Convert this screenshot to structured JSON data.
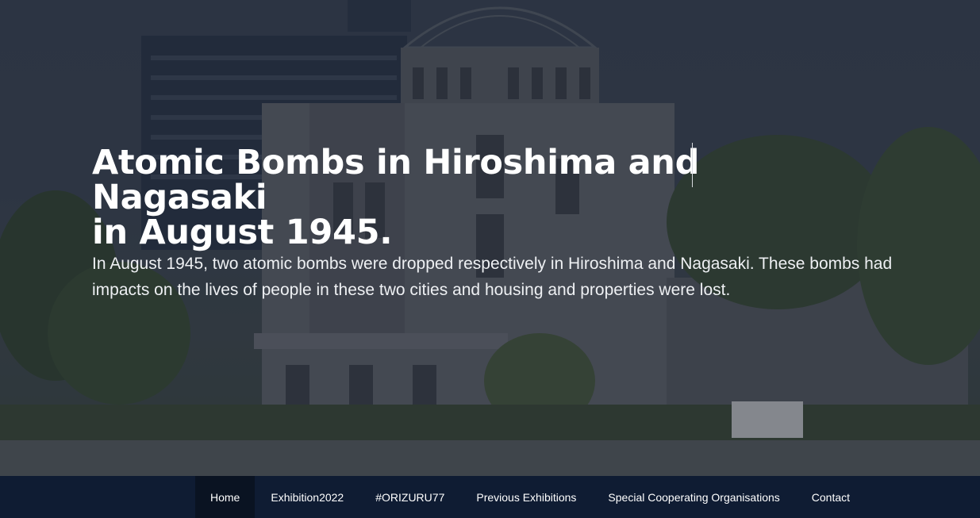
{
  "hero": {
    "title_line1": "Atomic Bombs in Hiroshima and Nagasaki",
    "title_line2": "in August 1945.",
    "lead": "In August 1945, two atomic bombs were dropped respectively in Hiroshima and Nagasaki. These bombs had impacts on the lives of people in these two cities and housing and properties were lost."
  },
  "nav": {
    "items": [
      {
        "label": "Home",
        "active": true
      },
      {
        "label": "Exhibition2022",
        "active": false
      },
      {
        "label": "#ORIZURU77",
        "active": false
      },
      {
        "label": "Previous Exhibitions",
        "active": false
      },
      {
        "label": "Special Cooperating Organisations",
        "active": false
      },
      {
        "label": "Contact",
        "active": false
      }
    ]
  },
  "colors": {
    "navbar": "#0f1c33",
    "nav_active": "#0a1322",
    "overlay": "#141c2d"
  }
}
